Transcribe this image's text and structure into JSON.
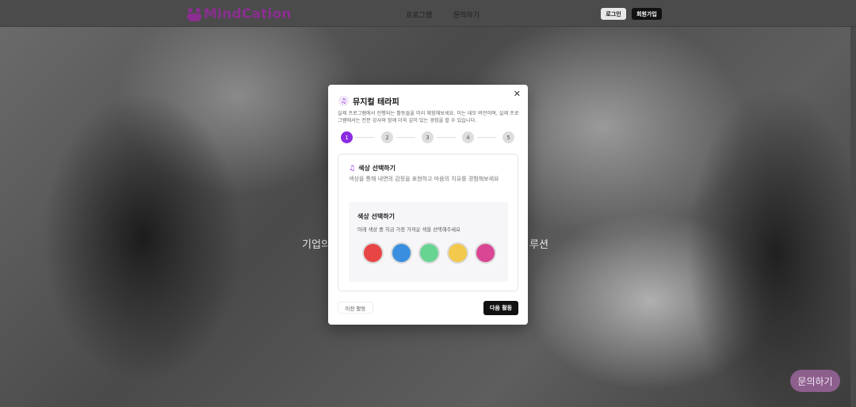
{
  "nav": {
    "brand": "MindCation",
    "links": [
      "프로그램",
      "문의하기"
    ],
    "login": "로그인",
    "signup": "회원가입"
  },
  "hero": {
    "left_text": "기업의",
    "right_text": "루션"
  },
  "fab": {
    "label": "문의하기"
  },
  "modal": {
    "title": "뮤지컬 테라피",
    "description": "실제 프로그램에서 진행되는 활동들을 미리 체험해보세요. 이는 데모 버전이며, 실제 프로그램에서는 전문 강사와 함께 더욱 깊이 있는 경험을 할 수 있습니다.",
    "close_icon": "close-icon",
    "steps": [
      "1",
      "2",
      "3",
      "4",
      "5"
    ],
    "active_step": 1,
    "card": {
      "title": "색상 선택하기",
      "subtitle": "색상을 통해 내면의 감정을 표현하고 마음의 치유를 경험해보세요",
      "inner_title": "색상 선택하기",
      "inner_subtitle": "아래 색상 중 지금 가장 가까운 색을 선택해주세요",
      "colors": [
        "#e84545",
        "#3a8ee0",
        "#67d492",
        "#f2c94c",
        "#d94694"
      ]
    },
    "prev_label": "이전 활동",
    "next_label": "다음 활동"
  },
  "colors": {
    "accent": "#8a2be2",
    "brand": "#8a2f8f"
  }
}
